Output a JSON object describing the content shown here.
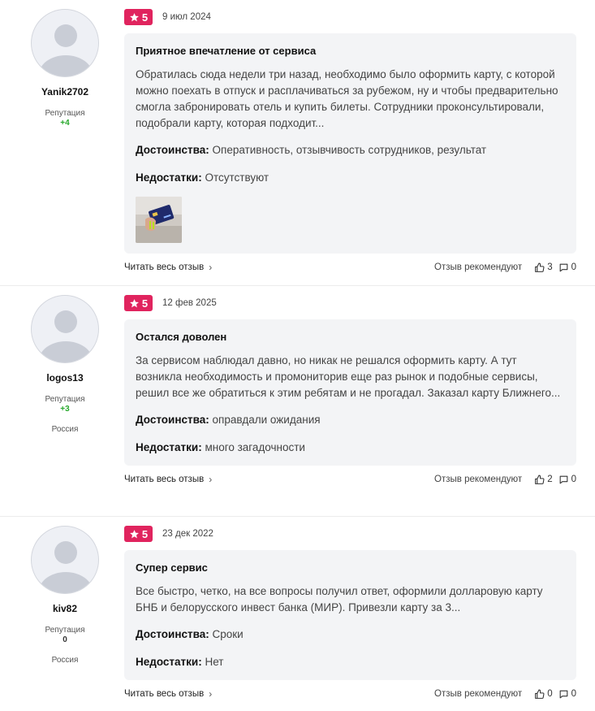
{
  "colors": {
    "accent": "#e0245e",
    "rep_positive": "#27a82c",
    "card_bg": "#f3f4f6"
  },
  "icons": {
    "rating": "star-icon",
    "read_more": "chevron-right-icon",
    "like": "thumbs-up-icon",
    "comment": "comment-icon"
  },
  "reviews": [
    {
      "user": {
        "name": "Yanik2702",
        "rep_label": "Репутация",
        "rep_value": "+4",
        "country": ""
      },
      "rating": "5",
      "date": "9 июл 2024",
      "title": "Приятное впечатление от сервиса",
      "text": "Обратилась сюда недели три назад, необходимо было оформить карту, с которой можно поехать в отпуск и расплачиваться за рубежом, ну и чтобы предварительно смогла забронировать отель и купить билеты. Сотрудники проконсультировали, подобрали карту, которая подходит...",
      "pros_label": "Достоинства:",
      "pros": "Оперативность, отзывчивость сотрудников, результат",
      "cons_label": "Недостатки:",
      "cons": "Отсутствуют",
      "read_more": "Читать весь отзыв",
      "recommend_label": "Отзыв рекомендуют",
      "likes": "3",
      "comments": "0"
    },
    {
      "user": {
        "name": "logos13",
        "rep_label": "Репутация",
        "rep_value": "+3",
        "country": "Россия"
      },
      "rating": "5",
      "date": "12 фев 2025",
      "title": "Остался доволен",
      "text": "За сервисом наблюдал давно, но никак не решался оформить карту. А тут возникла необходимость и промониторив еще раз рынок и подобные сервисы, решил все же обратиться к этим ребятам и не прогадал. Заказал карту Ближнего...",
      "pros_label": "Достоинства:",
      "pros": "оправдали ожидания",
      "cons_label": "Недостатки:",
      "cons": "много загадочности",
      "read_more": "Читать весь отзыв",
      "recommend_label": "Отзыв рекомендуют",
      "likes": "2",
      "comments": "0"
    },
    {
      "user": {
        "name": "kiv82",
        "rep_label": "Репутация",
        "rep_value": "0",
        "country": "Россия"
      },
      "rating": "5",
      "date": "23 дек 2022",
      "title": "Супер сервис",
      "text": "Все быстро, четко, на все вопросы получил ответ, оформили долларовую карту БНБ и белорусского инвест банка (МИР). Привезли карту за 3...",
      "pros_label": "Достоинства:",
      "pros": "Сроки",
      "cons_label": "Недостатки:",
      "cons": "Нет",
      "read_more": "Читать весь отзыв",
      "recommend_label": "Отзыв рекомендуют",
      "likes": "0",
      "comments": "0"
    }
  ]
}
